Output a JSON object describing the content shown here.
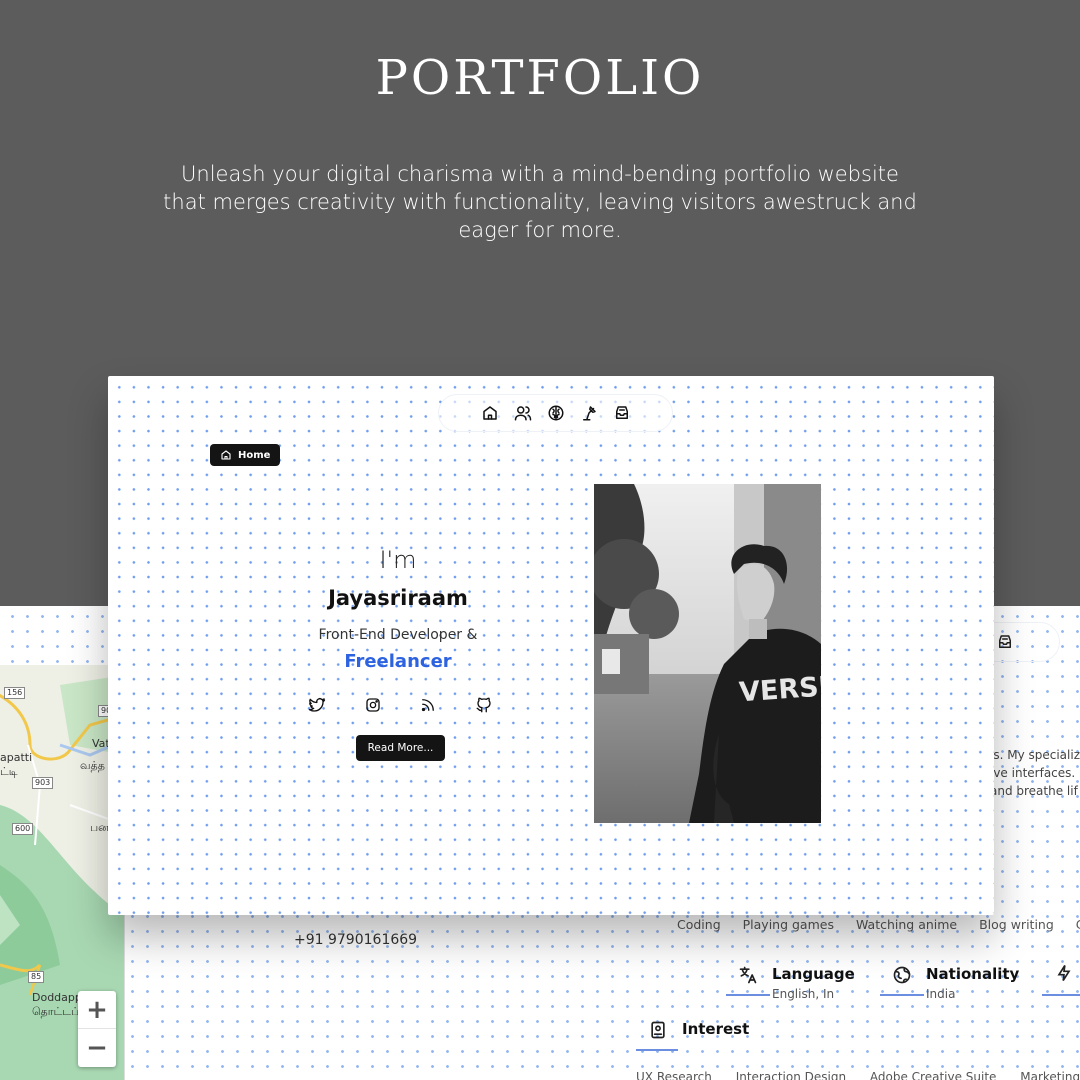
{
  "promo": {
    "title": "PORTFOLIO",
    "subtitle": "Unleash your digital charisma with a mind-bending portfolio website that merges creativity with functionality, leaving visitors awestruck and eager for more."
  },
  "card": {
    "nav": [
      {
        "name": "home",
        "icon": "home-icon"
      },
      {
        "name": "about",
        "icon": "users-icon"
      },
      {
        "name": "skills",
        "icon": "brain-icon"
      },
      {
        "name": "projects",
        "icon": "lamp-icon"
      },
      {
        "name": "contact",
        "icon": "inbox-icon"
      }
    ],
    "tooltip": "Home",
    "hero": {
      "greeting": "I'm",
      "name": "Jayasriraam",
      "role": "Front-End Developer &",
      "role_highlight": "Freelancer"
    },
    "socials": [
      "twitter-icon",
      "instagram-icon",
      "rss-icon",
      "github-icon"
    ],
    "read_more": "Read More...",
    "photo_text": "VERSUS"
  },
  "background_page": {
    "phone": "+91 9790161669",
    "about_lines": [
      "js. My specializ",
      "ive interfaces. I",
      "and breathe lif"
    ],
    "hobbies": [
      "Coding",
      "Playing games",
      "Watching anime",
      "Blog writing",
      "Cr"
    ],
    "info": [
      {
        "label": "Language",
        "value": "English, In",
        "icon": "translate-icon"
      },
      {
        "label": "Nationality",
        "value": "India",
        "icon": "globe-icon"
      }
    ],
    "interest_title": "Interest",
    "interests": [
      "UX Research",
      "Interaction Design",
      "Adobe Creative Suite",
      "Marketing S"
    ],
    "map": {
      "labels": [
        "apatti",
        "ட்டி",
        "Vat",
        "வத்த",
        "பன",
        "Doddapp",
        "தொட்டப்ப"
      ],
      "roads": [
        "156",
        "90",
        "903",
        "600",
        "85"
      ],
      "zoom_in": "+",
      "zoom_out": "−"
    },
    "accent": "#2d63e0"
  }
}
